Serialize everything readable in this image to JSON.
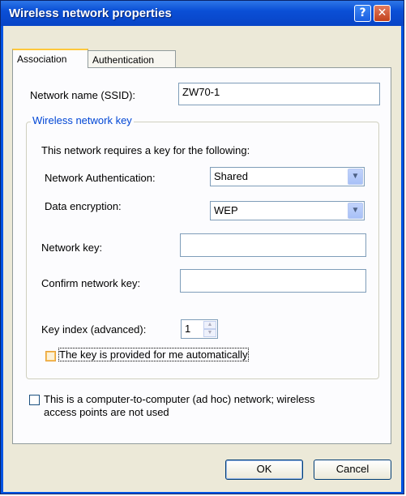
{
  "window": {
    "title": "Wireless network properties"
  },
  "tabs": [
    {
      "label": "Association",
      "active": true
    },
    {
      "label": "Authentication",
      "active": false
    }
  ],
  "association": {
    "ssid_label": "Network name (SSID):",
    "ssid_value": "ZW70-1",
    "group_title": "Wireless network key",
    "requires_text": "This network requires a key for the following:",
    "auth_label": "Network Authentication:",
    "auth_value": "Shared",
    "enc_label": "Data encryption:",
    "enc_value": "WEP",
    "netkey_label": "Network key:",
    "netkey_value": "",
    "confirm_label": "Confirm network key:",
    "confirm_value": "",
    "keyindex_label": "Key index (advanced):",
    "keyindex_value": "1",
    "auto_key_label": "The key is provided for me automatically",
    "adhoc_label_line1": "This is a computer-to-computer (ad hoc) network; wireless",
    "adhoc_label_line2": "access points are not used"
  },
  "buttons": {
    "ok": "OK",
    "cancel": "Cancel"
  },
  "icons": {
    "help": "help-icon",
    "close": "close-icon",
    "dropdown": "chevron-down-icon"
  },
  "colors": {
    "titlebar": "#0a4fd6",
    "group_title": "#0046d5",
    "face": "#ece9d8"
  }
}
